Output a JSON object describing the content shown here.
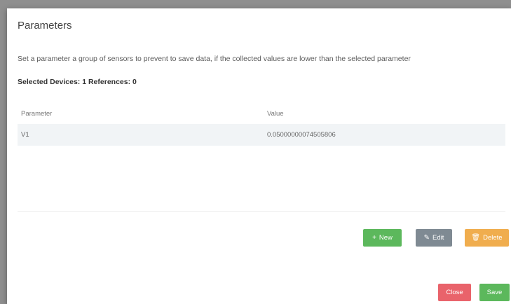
{
  "dialog": {
    "title": "Parameters",
    "description": "Set a parameter a group of sensors to prevent to save data, if the collected values are lower than the selected parameter",
    "selected_info": "Selected Devices: 1 References: 0"
  },
  "table": {
    "headers": {
      "parameter": "Parameter",
      "value": "Value"
    },
    "rows": [
      {
        "parameter": "V1",
        "value": "0.05000000074505806"
      }
    ]
  },
  "actions": {
    "new_label": "New",
    "edit_label": "Edit",
    "delete_label": "Delete",
    "new_icon": "plus-icon",
    "edit_icon": "pencil-icon",
    "delete_icon": "trash-icon"
  },
  "footer": {
    "close_label": "Close",
    "save_label": "Save"
  },
  "colors": {
    "success": "#5cb85c",
    "secondary": "#7f8a93",
    "warning": "#f0ad4e",
    "danger": "#e9636b"
  }
}
